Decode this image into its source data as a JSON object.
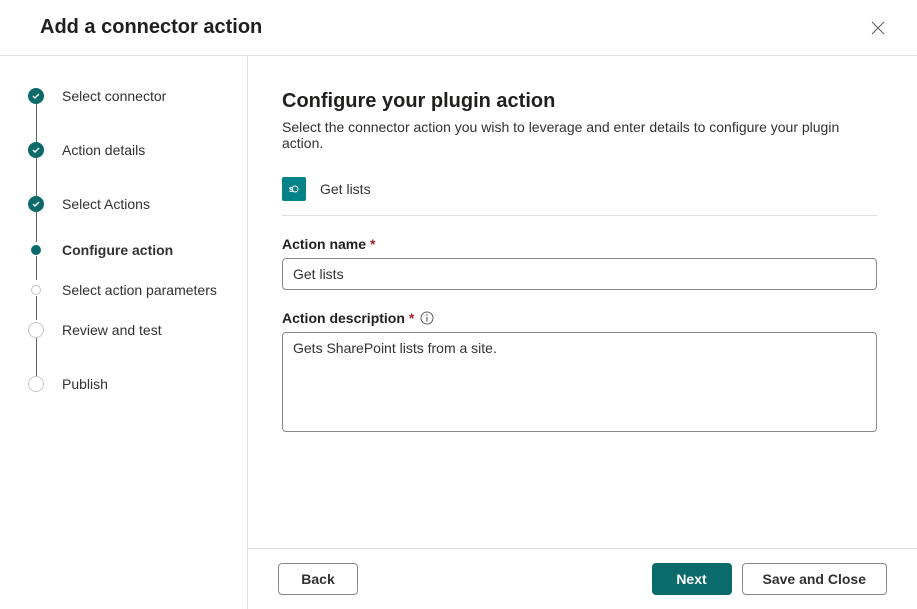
{
  "dialog": {
    "title": "Add a connector action"
  },
  "steps": [
    {
      "label": "Select connector",
      "state": "completed"
    },
    {
      "label": "Action details",
      "state": "completed"
    },
    {
      "label": "Select Actions",
      "state": "completed"
    },
    {
      "label": "Configure action",
      "state": "current"
    },
    {
      "label": "Select action parameters",
      "state": "upcoming-small"
    },
    {
      "label": "Review and test",
      "state": "upcoming-large"
    },
    {
      "label": "Publish",
      "state": "upcoming-large"
    }
  ],
  "main": {
    "heading": "Configure your plugin action",
    "subtitle": "Select the connector action you wish to leverage and enter details to configure your plugin action.",
    "selectedAction": {
      "iconText": "s",
      "name": "Get lists"
    },
    "fields": {
      "actionName": {
        "label": "Action name",
        "value": "Get lists"
      },
      "actionDescription": {
        "label": "Action description",
        "value": "Gets SharePoint lists from a site."
      }
    }
  },
  "footer": {
    "back": "Back",
    "next": "Next",
    "saveClose": "Save and Close"
  }
}
